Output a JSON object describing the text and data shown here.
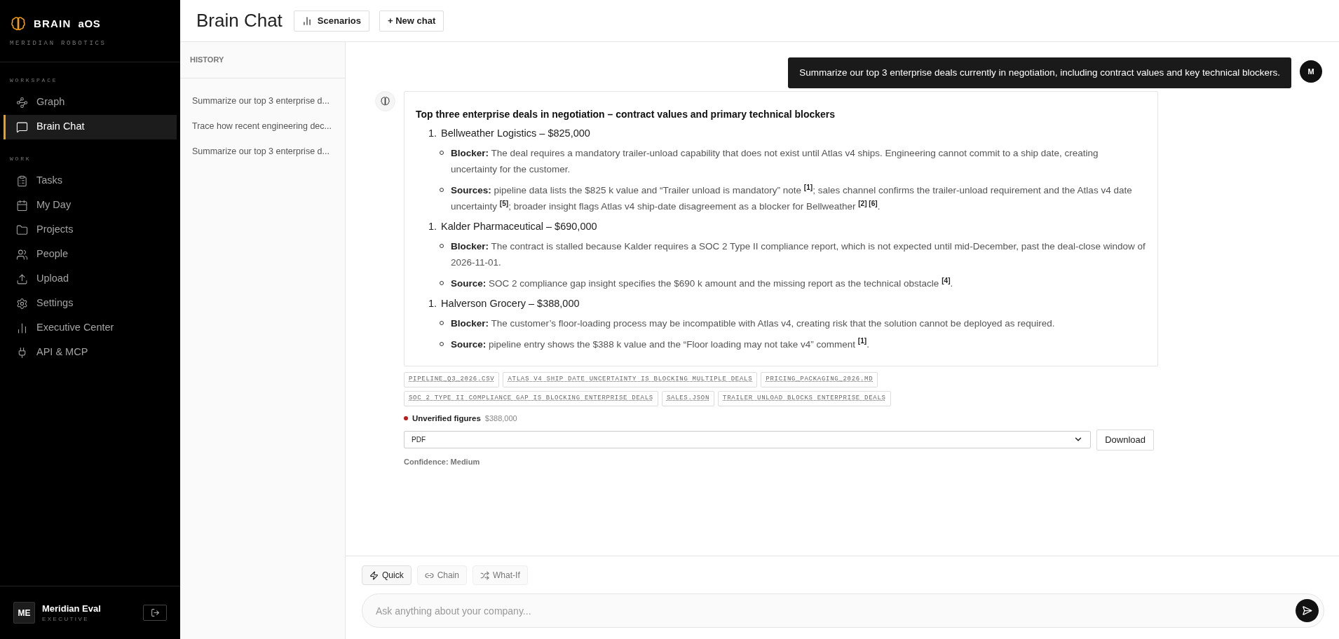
{
  "brand": {
    "name": "BRAIN",
    "suffix": "aOS",
    "company": "MERIDIAN ROBOTICS"
  },
  "sidebar": {
    "sections": [
      {
        "title": "WORKSPACE",
        "items": [
          {
            "label": "Graph",
            "selected": false
          },
          {
            "label": "Brain Chat",
            "selected": true
          }
        ]
      },
      {
        "title": "WORK",
        "items": [
          {
            "label": "Tasks",
            "selected": false
          },
          {
            "label": "My Day",
            "selected": false
          },
          {
            "label": "Projects",
            "selected": false
          },
          {
            "label": "People",
            "selected": false
          },
          {
            "label": "Upload",
            "selected": false
          },
          {
            "label": "Settings",
            "selected": false
          },
          {
            "label": "Executive Center",
            "selected": false
          },
          {
            "label": "API & MCP",
            "selected": false
          }
        ]
      }
    ],
    "user": {
      "initials": "ME",
      "name": "Meridian Eval",
      "role": "EXECUTIVE"
    }
  },
  "header": {
    "title": "Brain Chat",
    "buttons": [
      "Scenarios",
      "+ New chat"
    ]
  },
  "history": {
    "title": "HISTORY",
    "items": [
      {
        "label": "Summarize our top 3 enterprise d...",
        "selected": false
      },
      {
        "label": "Trace how recent engineering dec...",
        "selected": false
      },
      {
        "label": "Summarize our top 3 enterprise d...",
        "selected": false
      }
    ]
  },
  "user_message": {
    "text": "Summarize our top 3 enterprise deals currently in negotiation, including contract values and key technical blockers.",
    "avatar": "M"
  },
  "answer": {
    "title": "Top three enterprise deals in negotiation – contract values and primary technical blockers",
    "deals": [
      {
        "number": "1.",
        "heading": "Bellweather Logistics – $825,000",
        "points": [
          "**Blocker:** The deal requires a mandatory trailer-unload capability that does not exist until Atlas v4 ships. Engineering cannot commit to a ship date, creating uncertainty for the customer.",
          "**Sources:** pipeline data lists the $825 k value and “Trailer unload is mandatory” note $^{[1]}$; sales channel confirms the trailer-unload requirement and the Atlas v4 date uncertainty $^{[5]}$; broader insight flags Atlas v4 ship-date disagreement as a blocker for Bellweather $^{[2] [6]}$."
        ]
      },
      {
        "number": "1.",
        "heading": "Kalder Pharmaceutical – $690,000",
        "points": [
          "**Blocker:** The contract is stalled because Kalder requires a SOC 2 Type II compliance report, which is not expected until mid-December, past the deal-close window of 2026-11-01.",
          "**Source:** SOC 2 compliance gap insight specifies the $690 k amount and the missing report as the technical obstacle $^{[4]}$."
        ]
      },
      {
        "number": "1.",
        "heading": "Halverson Grocery – $388,000",
        "points": [
          "**Blocker:** The customer’s floor-loading process may be incompatible with Atlas v4, creating risk that the solution cannot be deployed as required.",
          "**Source:** pipeline entry shows the $388 k value and the “Floor loading may not take v4” comment $^{[1]}$."
        ]
      }
    ],
    "sources": [
      "PIPELINE_Q3_2026.CSV",
      "ATLAS V4 SHIP DATE UNCERTAINTY IS BLOCKING MULTIPLE DEALS",
      "PRICING_PACKAGING_2026.MD",
      "SOC 2 TYPE II COMPLIANCE GAP IS BLOCKING ENTERPRISE DEALS",
      "SALES.JSON",
      "TRAILER UNLOAD BLOCKS ENTERPRISE DEALS"
    ],
    "warning": {
      "label": "Unverified figures",
      "value": "$388,000",
      "color": "#b91c1c"
    },
    "export": {
      "format": "PDF",
      "button": "Download"
    },
    "confidence": "Confidence: Medium"
  },
  "composer": {
    "modes": [
      {
        "label": "Quick",
        "selected": true
      },
      {
        "label": "Chain",
        "selected": false
      },
      {
        "label": "What-If",
        "selected": false
      }
    ],
    "placeholder": "Ask anything about your company..."
  }
}
